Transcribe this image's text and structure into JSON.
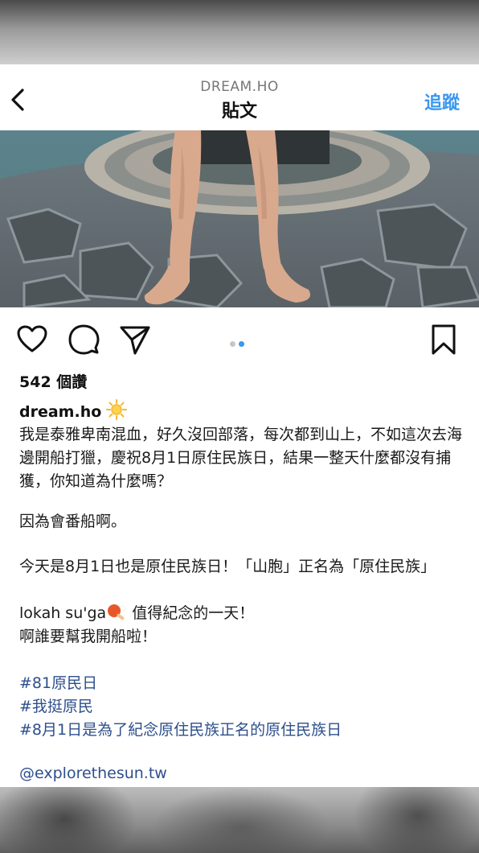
{
  "header": {
    "username_caps": "DREAM.HO",
    "title": "貼文",
    "follow_label": "追蹤"
  },
  "post": {
    "likes": "542 個讚",
    "username": "dream.ho",
    "caption_para1": "我是泰雅卑南混血，好久沒回部落，每次都到山上，不如這次去海邊開船打獵，慶祝8月1日原住民族日，結果一整天什麼都沒有捕獲，你知道為什麼嗎？",
    "caption_para2": "因為會番船啊。",
    "caption_para3": "今天是8月1日也是原住民族日！「山胞」正名為「原住民族」",
    "caption_line4_a": "lokah su'ga",
    "caption_line4_b": " 值得紀念的一天！",
    "caption_line5": "啊誰要幫我開船啦！",
    "hashtags": [
      "#81原民日",
      "#我挺原民",
      "#8月1日是為了紀念原住民族正名的原住民族日"
    ],
    "mention": "@explorethesun.tw"
  },
  "icons": {
    "back": "chevron-left-icon",
    "like": "heart-icon",
    "comment": "comment-bubble-icon",
    "share": "paper-plane-icon",
    "save": "bookmark-icon",
    "sun": "sun-emoji",
    "pingpong": "ping-pong-emoji"
  },
  "colors": {
    "accent": "#3897f0",
    "hashtag": "#2d4f8c",
    "dot_active": "#3897f0",
    "dot_inactive": "#c7c7c7"
  },
  "carousel": {
    "total_slides": 2,
    "active_slide": 2
  }
}
